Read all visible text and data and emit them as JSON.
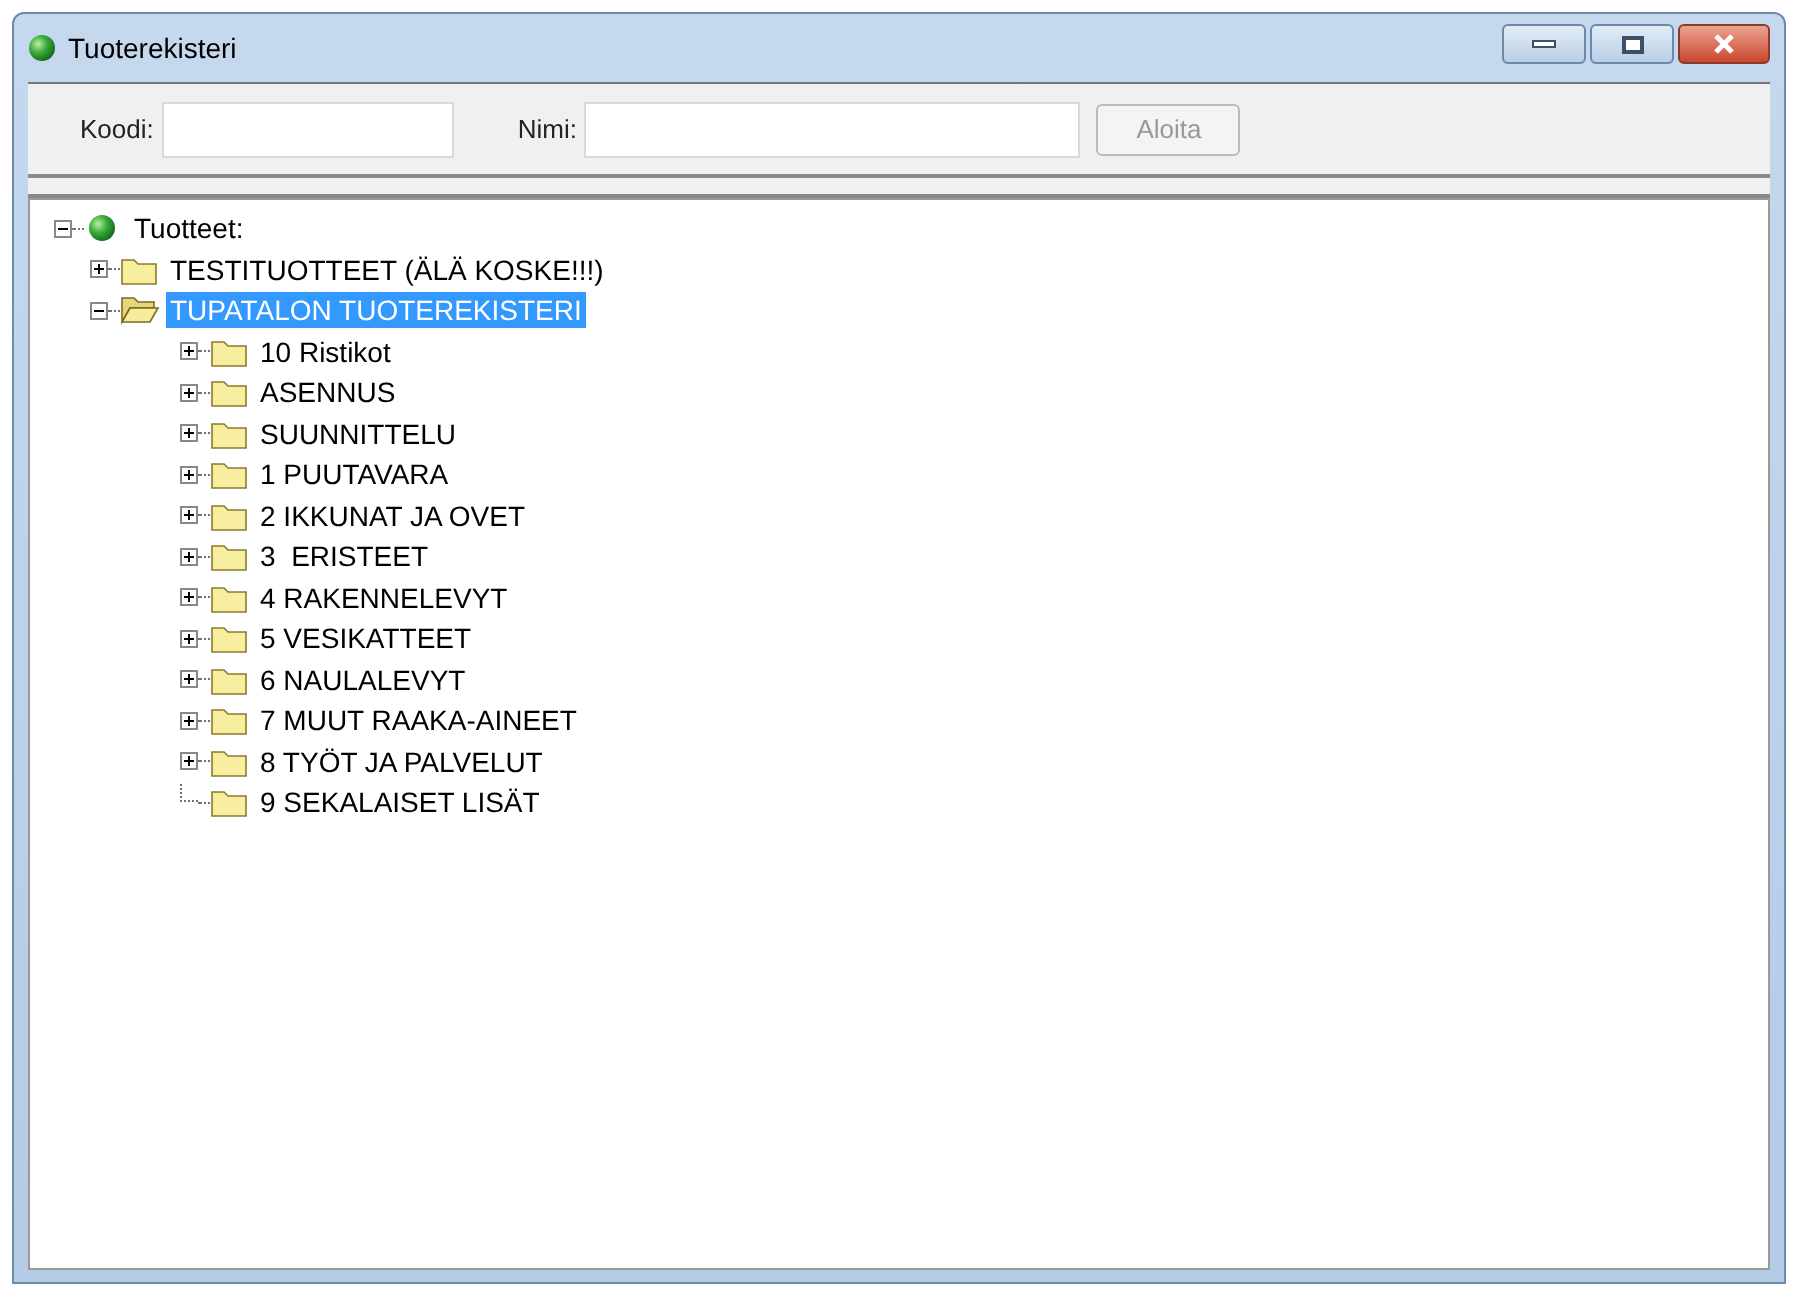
{
  "window": {
    "title": "Tuoterekisteri"
  },
  "search": {
    "code_label": "Koodi:",
    "name_label": "Nimi:",
    "button": "Aloita",
    "button_disabled": true
  },
  "tree": [
    {
      "label": "Tuotteet:",
      "kind": "root",
      "expandable": true,
      "expanded": true,
      "selected": false,
      "children": [
        {
          "label": "TESTITUOTTEET (ÄLÄ KOSKE!!!)",
          "kind": "folder",
          "expandable": true,
          "expanded": false,
          "selected": false
        },
        {
          "label": "TUPATALON TUOTEREKISTERI",
          "kind": "folder",
          "expandable": true,
          "expanded": true,
          "selected": true,
          "children": [
            {
              "label": "10 Ristikot",
              "kind": "folder",
              "expandable": true,
              "expanded": false,
              "selected": false
            },
            {
              "label": "ASENNUS",
              "kind": "folder",
              "expandable": true,
              "expanded": false,
              "selected": false
            },
            {
              "label": "SUUNNITTELU",
              "kind": "folder",
              "expandable": true,
              "expanded": false,
              "selected": false
            },
            {
              "label": "1 PUUTAVARA",
              "kind": "folder",
              "expandable": true,
              "expanded": false,
              "selected": false
            },
            {
              "label": "2 IKKUNAT JA OVET",
              "kind": "folder",
              "expandable": true,
              "expanded": false,
              "selected": false
            },
            {
              "label": "3  ERISTEET",
              "kind": "folder",
              "expandable": true,
              "expanded": false,
              "selected": false
            },
            {
              "label": "4 RAKENNELEVYT",
              "kind": "folder",
              "expandable": true,
              "expanded": false,
              "selected": false
            },
            {
              "label": "5 VESIKATTEET",
              "kind": "folder",
              "expandable": true,
              "expanded": false,
              "selected": false
            },
            {
              "label": "6 NAULALEVYT",
              "kind": "folder",
              "expandable": true,
              "expanded": false,
              "selected": false
            },
            {
              "label": "7 MUUT RAAKA-AINEET",
              "kind": "folder",
              "expandable": true,
              "expanded": false,
              "selected": false
            },
            {
              "label": "8 TYÖT JA PALVELUT",
              "kind": "folder",
              "expandable": true,
              "expanded": false,
              "selected": false
            },
            {
              "label": "9 SEKALAISET LISÄT",
              "kind": "folder",
              "expandable": false,
              "expanded": false,
              "selected": false
            }
          ]
        }
      ]
    }
  ]
}
